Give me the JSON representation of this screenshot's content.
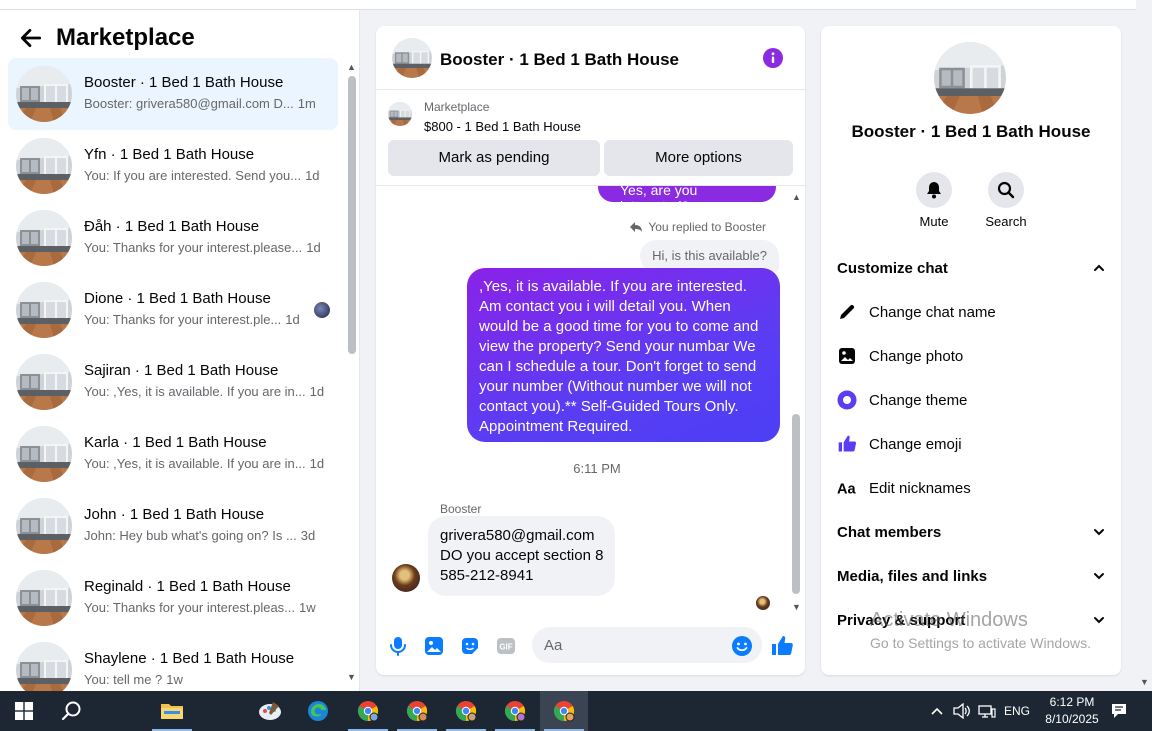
{
  "left": {
    "title": "Marketplace",
    "conversations": [
      {
        "name": "Booster · 1 Bed 1 Bath House",
        "preview": "Booster: grivera580@gmail.com D...",
        "time": "1m"
      },
      {
        "name": "Yfn · 1 Bed 1 Bath House",
        "preview": "You: If you are interested. Send you...",
        "time": "1d"
      },
      {
        "name": "Đåh · 1 Bed 1 Bath House",
        "preview": "You: Thanks for your interest.please...",
        "time": "1d"
      },
      {
        "name": "Dione · 1 Bed 1 Bath House",
        "preview": "You: Thanks for your interest.ple...",
        "time": "1d"
      },
      {
        "name": "Sajiran · 1 Bed 1 Bath House",
        "preview": "You: ,Yes, it is available. If you are in...",
        "time": "1d"
      },
      {
        "name": "Karla · 1 Bed 1 Bath House",
        "preview": "You: ,Yes, it is available. If you are in...",
        "time": "1d"
      },
      {
        "name": "John · 1 Bed 1 Bath House",
        "preview": "John: Hey bub what's going on? Is ...",
        "time": "3d"
      },
      {
        "name": "Reginald · 1 Bed 1 Bath House",
        "preview": "You: Thanks for your interest.pleas...",
        "time": "1w"
      },
      {
        "name": "Shaylene · 1 Bed 1 Bath House",
        "preview": "You: tell me ?",
        "time": "1w"
      }
    ]
  },
  "chat": {
    "title": "Booster · 1 Bed 1 Bath House",
    "listing_source": "Marketplace",
    "listing_price": "$800 - 1 Bed 1 Bath House",
    "mark_pending": "Mark as pending",
    "more_options": "More options",
    "partial_bubble": "Yes, are you interested?",
    "replied_to": "You replied to Booster",
    "quoted": "Hi, is this available?",
    "outgoing": ",Yes, it is available. If you are interested. Am contact you i will detail you.  When would be a good time for you to come and view the property? Send your numbar We can I schedule a tour.  Don't forget to send your number (Without number we will not contact you).** Self-Guided Tours Only. Appointment Required.",
    "timestamp": "6:11 PM",
    "sender": "Booster",
    "incoming_line1": "grivera580@gmail.com",
    "incoming_line2": "DO you accept section 8",
    "incoming_line3": "585-212-8941",
    "input_placeholder": "Aa"
  },
  "details": {
    "title": "Booster · 1 Bed 1 Bath House",
    "mute": "Mute",
    "search": "Search",
    "customize": "Customize chat",
    "change_name": "Change chat name",
    "change_photo": "Change photo",
    "change_theme": "Change theme",
    "change_emoji": "Change emoji",
    "edit_nicknames": "Edit nicknames",
    "chat_members": "Chat members",
    "media": "Media, files and links",
    "privacy": "Privacy & support"
  },
  "watermark": {
    "line1": "Activate Windows",
    "line2": "Go to Settings to activate Windows."
  },
  "taskbar": {
    "language": "ENG",
    "time": "6:12 PM",
    "date": "8/10/2025"
  },
  "colors": {
    "accent": "#7c2ae8",
    "bubble_gradient_start": "#8b22e8",
    "bubble_gradient_end": "#4b3ff5",
    "active_conversation": "#ebf5ff",
    "taskbar": "#1c2733"
  }
}
